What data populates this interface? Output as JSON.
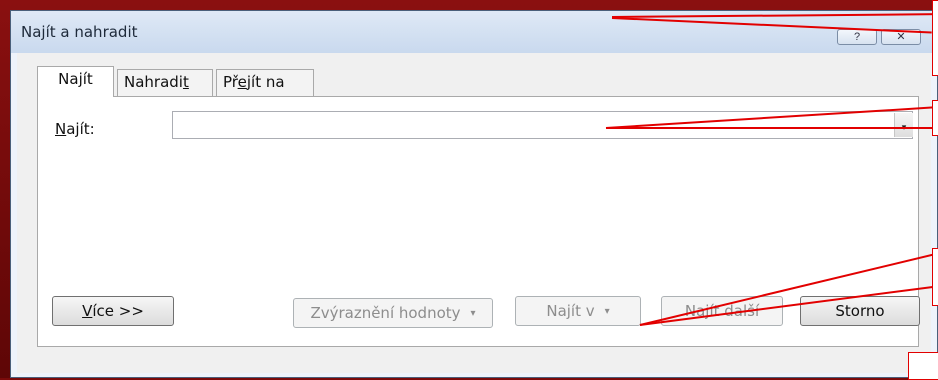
{
  "window": {
    "title": "Najít a nahradit",
    "help_button": "?",
    "close_button": "✕"
  },
  "tabs": [
    {
      "pre": "Na",
      "key": "j",
      "post": "ít"
    },
    {
      "pre": "Nahradi",
      "key": "t",
      "post": ""
    },
    {
      "pre": "Př",
      "key": "e",
      "post": "jít na"
    }
  ],
  "find": {
    "label_key": "N",
    "label_rest": "ajít:",
    "value": "",
    "dropdown_icon": "▾"
  },
  "buttons": {
    "more_key": "V",
    "more_rest": "íce >>",
    "highlight": "Zvýraznění hodnoty",
    "find_in": "Najít v",
    "caret": "▾",
    "find_next": "Najít další",
    "cancel": "Storno"
  },
  "colors": {
    "annotation": "#e20000",
    "background_frame": "#7a0a0a"
  }
}
